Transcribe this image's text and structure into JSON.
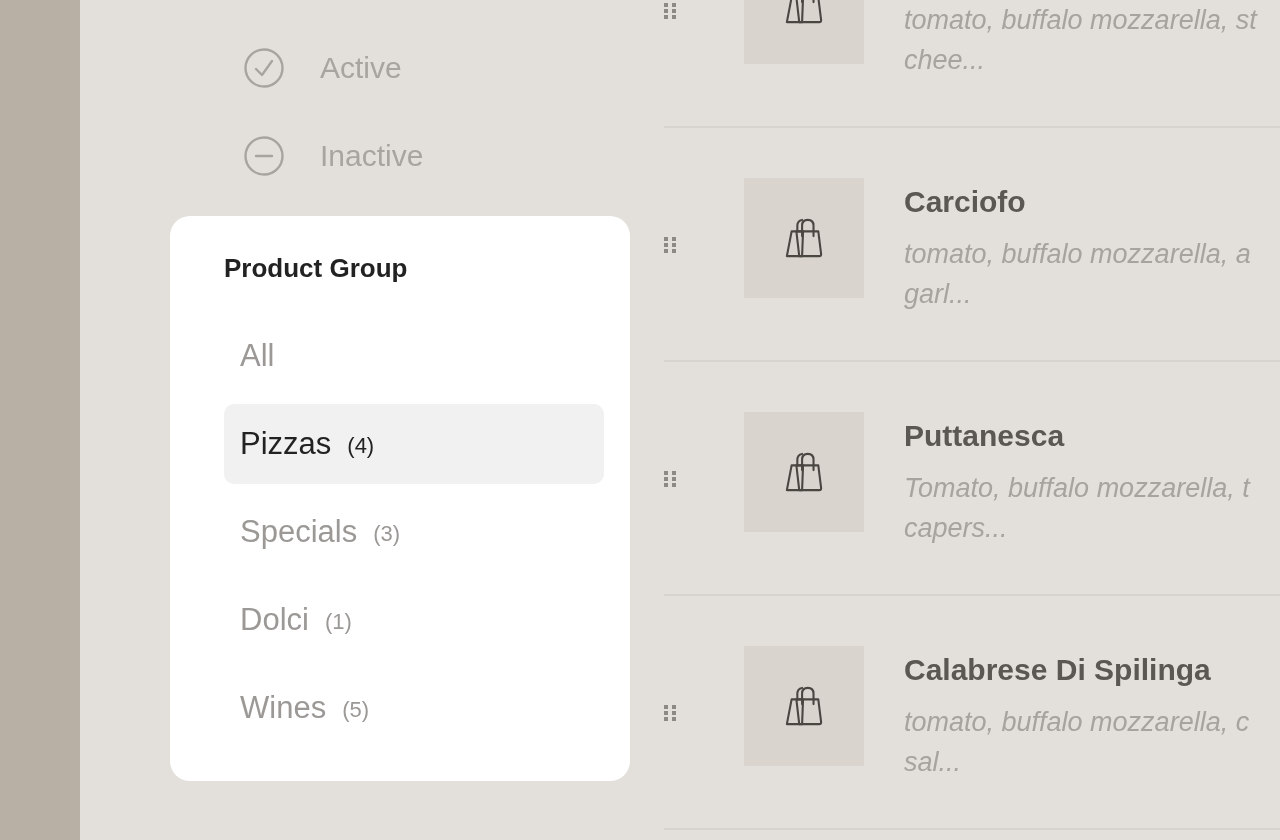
{
  "status_filter": [
    {
      "kind": "active",
      "label": "Active"
    },
    {
      "kind": "inactive",
      "label": "Inactive"
    }
  ],
  "product_group": {
    "title": "Product Group",
    "items": [
      {
        "label": "All",
        "selected": false
      },
      {
        "label": "Pizzas",
        "count": "(4)",
        "selected": true
      },
      {
        "label": "Specials",
        "count": "(3)",
        "selected": false
      },
      {
        "label": "Dolci",
        "count": "(1)",
        "selected": false
      },
      {
        "label": "Wines",
        "count": "(5)",
        "selected": false
      }
    ]
  },
  "products": [
    {
      "description": "tomato, buffalo mozzarella, st\nchee..."
    },
    {
      "name": "Carciofo",
      "description": "tomato, buffalo mozzarella, a\ngarl..."
    },
    {
      "name": "Puttanesca",
      "description": "Tomato, buffalo mozzarella, t\ncapers..."
    },
    {
      "name": "Calabrese Di Spilinga",
      "description": "tomato, buffalo mozzarella, c\nsal..."
    }
  ]
}
